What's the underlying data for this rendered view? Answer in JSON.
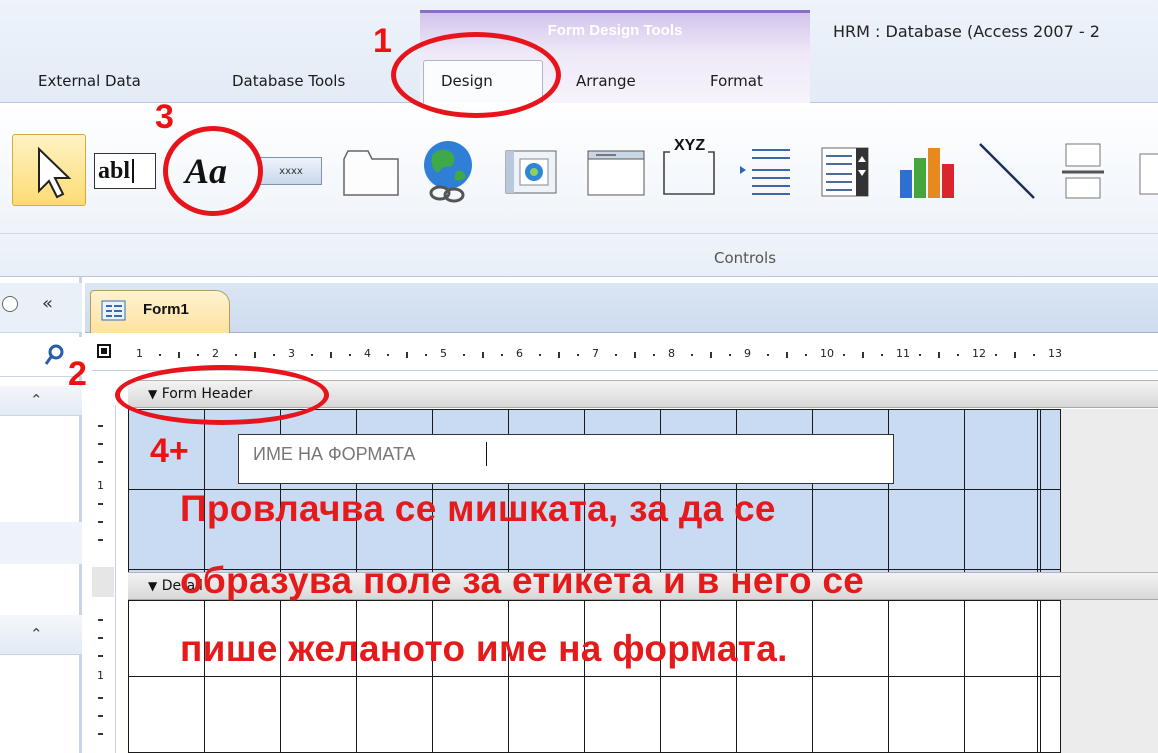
{
  "ribbon": {
    "contextual_title": "Form Design Tools",
    "app_title": "HRM : Database (Access 2007 - 2",
    "tabs": [
      "External Data",
      "Database Tools",
      "Design",
      "Arrange",
      "Format"
    ],
    "controls": {
      "textbox_label": "abl",
      "label_label": "Aa",
      "button_label": "xxxx",
      "xyz_label": "XYZ"
    },
    "group_label": "Controls"
  },
  "nav": {
    "collapse_glyph": "«",
    "expand_glyph": "⌃"
  },
  "document": {
    "tab_title": "Form1",
    "ruler_ticks": [
      "1",
      "2",
      "3",
      "4",
      "5",
      "6",
      "7",
      "8",
      "9",
      "10",
      "11",
      "12",
      "13"
    ],
    "vruler_marks": [
      "1",
      "1"
    ],
    "form_header": "Form Header",
    "detail": "Detail",
    "label_text": "ИМЕ НА ФОРМАТА"
  },
  "annotations": {
    "step1": "1",
    "step2": "2",
    "step3": "3",
    "step4": "4+",
    "instruction_lines": [
      "Провлачва се мишката, за да се",
      "образува поле за етикета и в него се",
      "пише желаното име на формата."
    ]
  },
  "colors": {
    "annotation_red": "#e8141c",
    "header_grid": "#c8dbf3",
    "contextual_purple": "#8a6fc3"
  }
}
